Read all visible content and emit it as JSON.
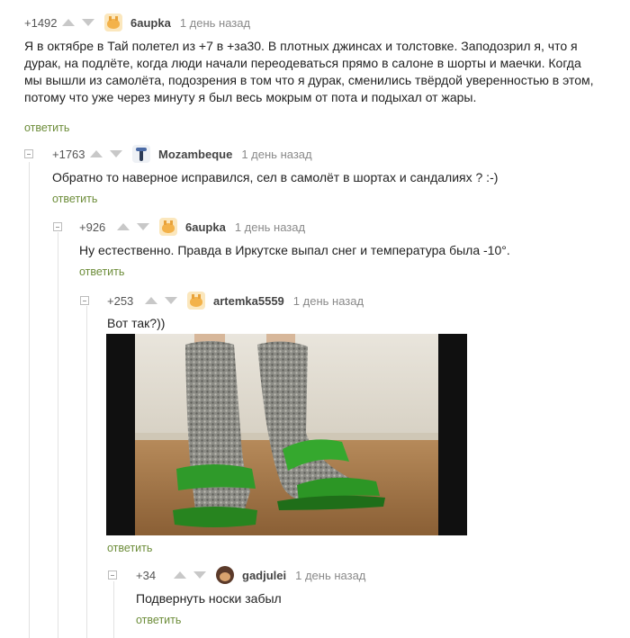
{
  "comments": [
    {
      "rating": "+1492",
      "author": "6aupka",
      "time": "1 день назад",
      "text": [
        "Я в октябре в Тай полетел из +7 в +за30. В плотных джинсах и толстовке. Заподозрил я, что я",
        "дурак, на подлёте, когда люди начали переодеваться прямо в салоне в шорты и маечки. Когда",
        "мы вышли из самолёта, подозрения в том что я дурак, сменились твёрдой уверенностью в этом,",
        "потому что уже через минуту я был весь мокрым от пота и подыхал от жары."
      ],
      "reply": "ответить",
      "avatar_icon": "cat-avatar-icon"
    },
    {
      "rating": "+1763",
      "author": "Mozambeque",
      "time": "1 день назад",
      "text": [
        "Обратно то наверное исправился, сел в самолёт в шортах и сандалиях ? :-)"
      ],
      "reply": "ответить",
      "avatar_icon": "figure-avatar-icon"
    },
    {
      "rating": "+926",
      "author": "6aupka",
      "time": "1 день назад",
      "text": [
        "Ну естественно. Правда в Иркутске выпал снег и температура была -10°."
      ],
      "reply": "ответить",
      "avatar_icon": "cat-avatar-icon"
    },
    {
      "rating": "+253",
      "author": "artemka5559",
      "time": "1 день назад",
      "text": [
        "Вот так?))"
      ],
      "reply": "ответить",
      "avatar_icon": "cat-avatar-icon"
    },
    {
      "rating": "+34",
      "author": "gadjulei",
      "time": "1 день назад",
      "text": [
        "Подвернуть носки забыл"
      ],
      "reply": "ответить",
      "avatar_icon": "person-avatar-icon"
    }
  ],
  "colors": {
    "reply_link": "#6d8d3a",
    "arrow": "#c8c8c8",
    "thread_line": "#e2e2e2"
  }
}
